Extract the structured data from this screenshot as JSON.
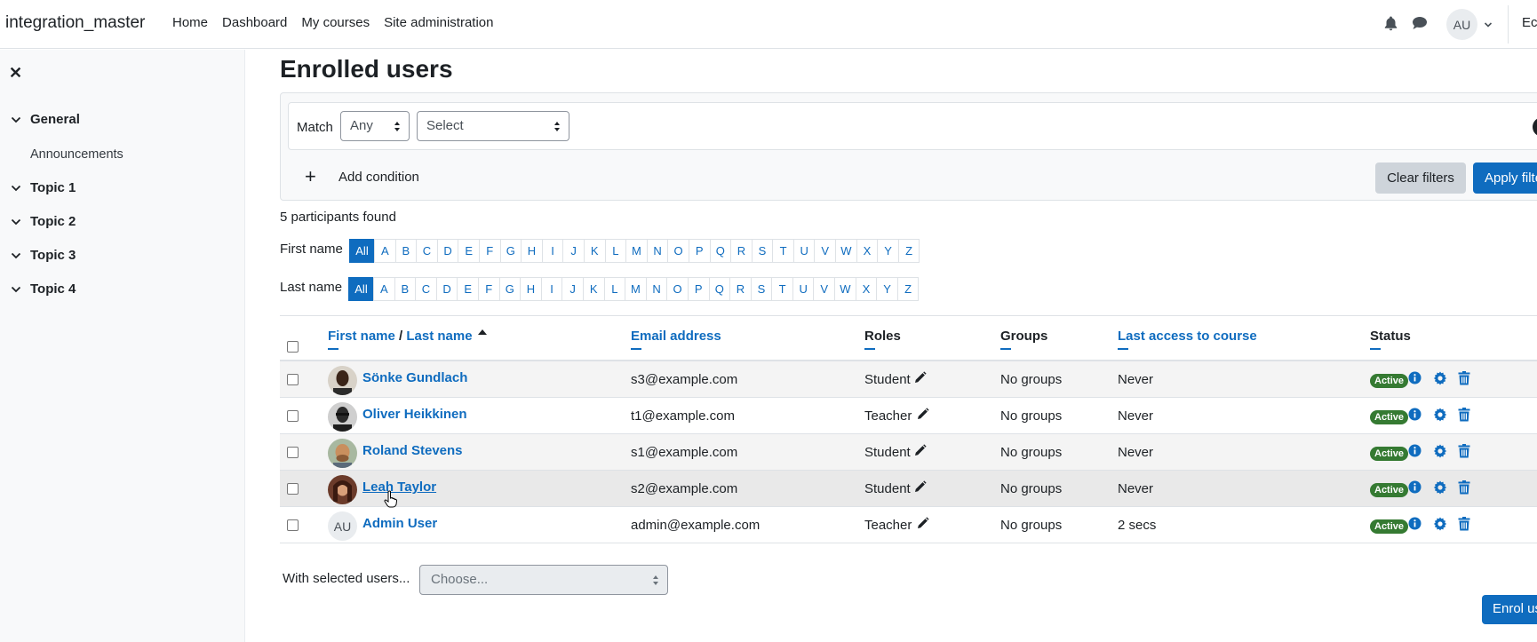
{
  "navbar": {
    "brand": "integration_master",
    "links": [
      "Home",
      "Dashboard",
      "My courses",
      "Site administration"
    ],
    "user_initials": "AU",
    "edit_mode_cut": "Ec"
  },
  "drawer": {
    "sections": [
      {
        "label": "General",
        "items": [
          "Announcements"
        ]
      },
      {
        "label": "Topic 1",
        "items": []
      },
      {
        "label": "Topic 2",
        "items": []
      },
      {
        "label": "Topic 3",
        "items": []
      },
      {
        "label": "Topic 4",
        "items": []
      }
    ]
  },
  "main": {
    "title": "Enrolled users",
    "filter": {
      "match_label": "Match",
      "match_value": "Any",
      "select_value": "Select",
      "add_condition": "Add condition",
      "clear_filters": "Clear filters",
      "apply_filters": "Apply filters"
    },
    "found_text": "5 participants found",
    "first_name_label": "First name",
    "last_name_label": "Last name",
    "letters": [
      "All",
      "A",
      "B",
      "C",
      "D",
      "E",
      "F",
      "G",
      "H",
      "I",
      "J",
      "K",
      "L",
      "M",
      "N",
      "O",
      "P",
      "Q",
      "R",
      "S",
      "T",
      "U",
      "V",
      "W",
      "X",
      "Y",
      "Z"
    ],
    "table": {
      "headers": {
        "first_name": "First name",
        "separator": "/",
        "last_name": "Last name",
        "email": "Email address",
        "roles": "Roles",
        "groups": "Groups",
        "last_access": "Last access to course",
        "status": "Status"
      },
      "rows": [
        {
          "name": "Sönke Gundlach",
          "email": "s3@example.com",
          "role": "Student",
          "groups": "No groups",
          "last_access": "Never",
          "status": "Active"
        },
        {
          "name": "Oliver Heikkinen",
          "email": "t1@example.com",
          "role": "Teacher",
          "groups": "No groups",
          "last_access": "Never",
          "status": "Active"
        },
        {
          "name": "Roland Stevens",
          "email": "s1@example.com",
          "role": "Student",
          "groups": "No groups",
          "last_access": "Never",
          "status": "Active"
        },
        {
          "name": "Leah Taylor",
          "email": "s2@example.com",
          "role": "Student",
          "groups": "No groups",
          "last_access": "Never",
          "status": "Active"
        },
        {
          "name": "Admin User",
          "avatar_initials": "AU",
          "email": "admin@example.com",
          "role": "Teacher",
          "groups": "No groups",
          "last_access": "2 secs",
          "status": "Active"
        }
      ]
    },
    "with_selected_label": "With selected users...",
    "choose_placeholder": "Choose...",
    "enrol_button": "Enrol users"
  },
  "colors": {
    "primary": "#0f6cbf",
    "active_badge": "#357a32",
    "clear_button": "#ced4da"
  },
  "icons": [
    "bell-icon",
    "chat-icon",
    "chevron-down-icon",
    "close-icon",
    "plus-icon",
    "pencil-icon",
    "info-icon",
    "gear-icon",
    "trash-icon"
  ]
}
